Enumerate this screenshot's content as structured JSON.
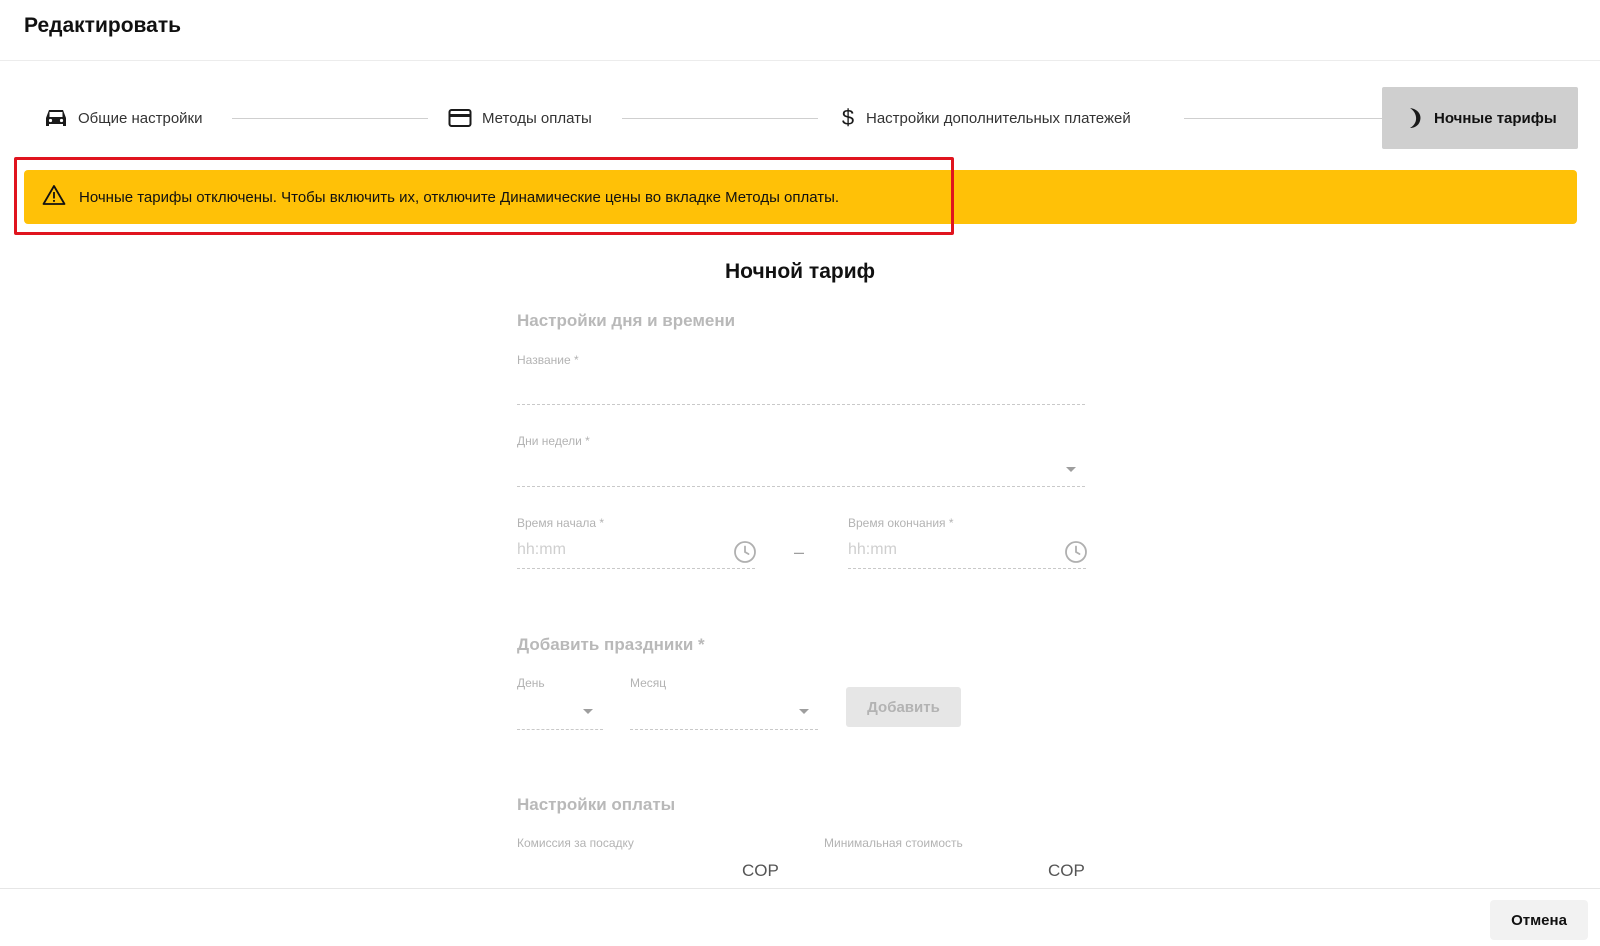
{
  "header": {
    "title": "Редактировать"
  },
  "stepper": {
    "steps": [
      {
        "label": "Общие настройки",
        "icon": "car-icon"
      },
      {
        "label": "Методы оплаты",
        "icon": "credit-card-icon"
      },
      {
        "label": "Настройки дополнительных платежей",
        "icon": "dollar-icon"
      },
      {
        "label": "Ночные тарифы",
        "icon": "moon-icon",
        "active": true
      }
    ]
  },
  "alert": {
    "text": "Ночные тарифы отключены. Чтобы включить их, отключите Динамические цены во вкладке Методы оплаты.",
    "icon": "warning-icon",
    "color": "#ffc107"
  },
  "form": {
    "title": "Ночной тариф",
    "datetime_section": {
      "title": "Настройки дня и времени",
      "name_label": "Название *",
      "days_label": "Дни недели *",
      "start_label": "Время начала *",
      "start_placeholder": "hh:mm",
      "end_label": "Время окончания *",
      "end_placeholder": "hh:mm",
      "range_separator": "–"
    },
    "holidays_section": {
      "title": "Добавить праздники *",
      "day_label": "День",
      "month_label": "Месяц",
      "add_button": "Добавить"
    },
    "payment_section": {
      "title": "Настройки оплаты",
      "fee_label": "Комиссия за посадку",
      "fee_currency": "COP",
      "min_label": "Минимальная стоимость",
      "min_currency": "COP"
    }
  },
  "footer": {
    "cancel_button": "Отмена"
  },
  "colors": {
    "accent": "#ffc107",
    "highlight": "#e0141e",
    "active_step_bg": "#cfcfcf"
  }
}
